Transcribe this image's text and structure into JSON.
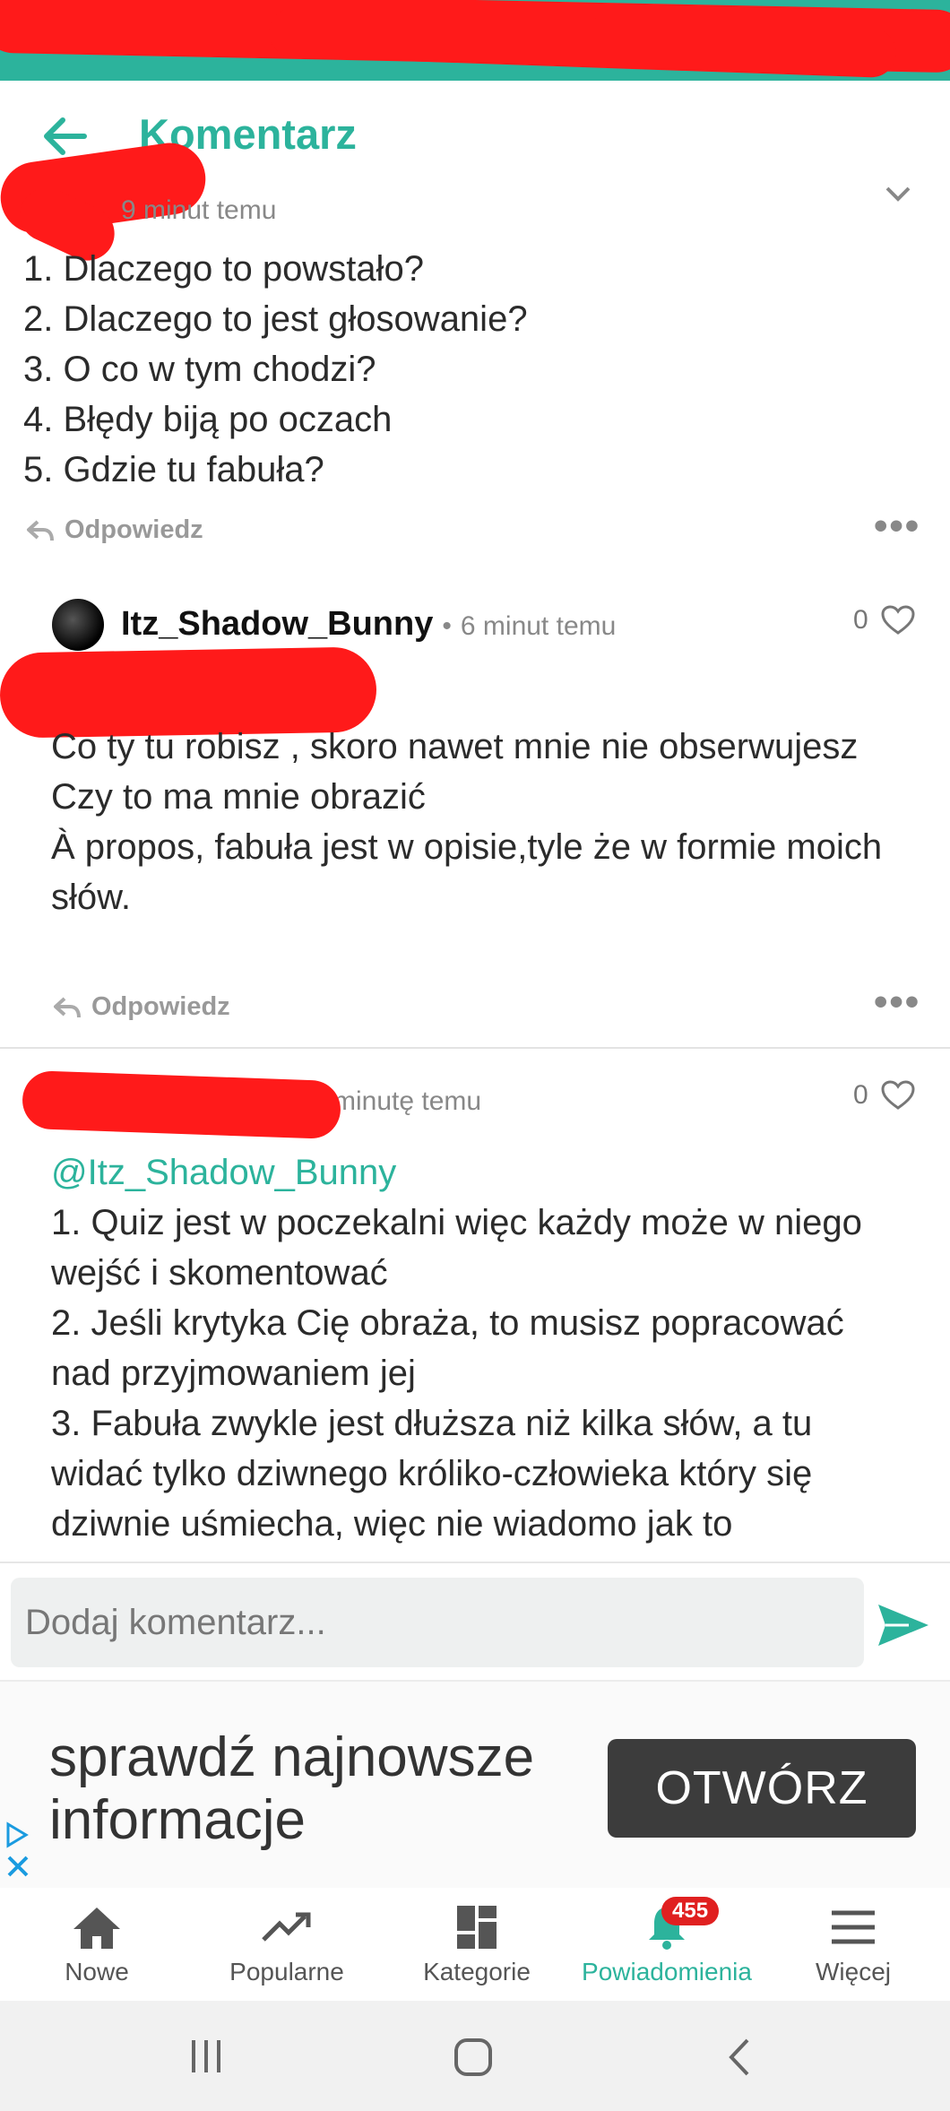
{
  "app_bar": {
    "title": "Komentarz"
  },
  "comments": [
    {
      "timestamp": "9 minut temu",
      "text": "1. Dlaczego to powstało?\n2. Dlaczego to jest głosowanie?\n3. O co w tym chodzi?\n4. Błędy biją po oczach\n5. Gdzie tu fabuła?",
      "reply_label": "Odpowiedz"
    },
    {
      "username": "Itz_Shadow_Bunny",
      "separator": "•",
      "timestamp": "6 minut temu",
      "likes": "0",
      "text": "Co ty tu robisz , skoro nawet mnie nie obserwujesz\nCzy to ma mnie obrazić\nÀ propos, fabuła jest w opisie,tyle że w formie moich słów.",
      "reply_label": "Odpowiedz"
    },
    {
      "timestamp": "minutę temu",
      "likes": "0",
      "mention": "@Itz_Shadow_Bunny",
      "text": "1. Quiz jest w poczekalni więc każdy może w niego wejść i skomentować\n2. Jeśli krytyka Cię obraża, to musisz popracować nad przyjmowaniem jej\n3. Fabuła zwykle jest dłuższa niż kilka słów, a tu widać tylko dziwnego króliko-człowieka który się dziwnie uśmiecha, więc nie wiadomo jak to"
    }
  ],
  "input": {
    "placeholder": "Dodaj komentarz..."
  },
  "ad": {
    "text_line1": "sprawdź najnowsze",
    "text_line2": "informacje",
    "button": "OTWÓRZ"
  },
  "bottom_nav": {
    "items": [
      {
        "label": "Nowe",
        "icon": "home-icon"
      },
      {
        "label": "Popularne",
        "icon": "trending-icon"
      },
      {
        "label": "Kategorie",
        "icon": "grid-icon"
      },
      {
        "label": "Powiadomienia",
        "icon": "bell-icon",
        "badge": "455"
      },
      {
        "label": "Więcej",
        "icon": "menu-icon"
      }
    ]
  },
  "colors": {
    "accent": "#2cb39c",
    "badge": "#e02020",
    "redaction": "#ff1a1a"
  }
}
